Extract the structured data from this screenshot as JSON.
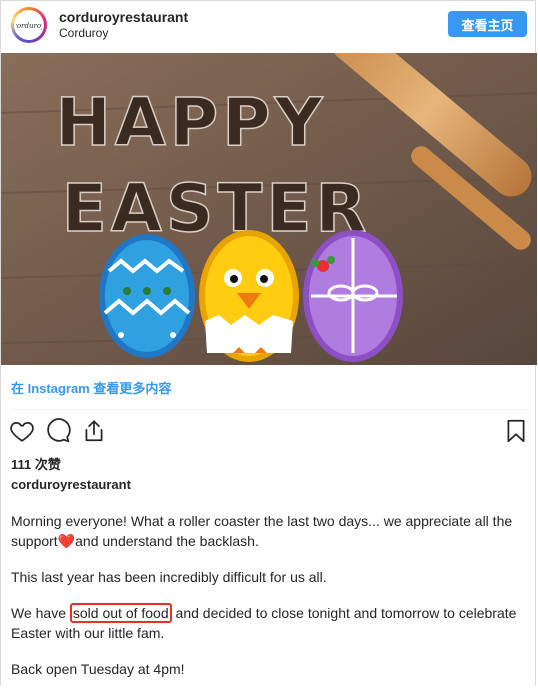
{
  "header": {
    "username": "corduroyrestaurant",
    "sublabel": "Corduroy",
    "view_profile_button": "查看主页",
    "avatar_text": "corduroy"
  },
  "photo": {
    "line1": "HAPPY",
    "line2": "EASTER"
  },
  "view_more_link": "在 Instagram 查看更多内容",
  "actions": {
    "icons": [
      "heart-icon",
      "comment-icon",
      "share-icon",
      "bookmark-icon"
    ]
  },
  "likes_text": "111 次赞",
  "author": "corduroyrestaurant",
  "caption": {
    "p1_a": "Morning everyone! What a roller coaster the last two days... we appreciate all the support",
    "p1_emoji": "❤️",
    "p1_b": "and understand the backlash.",
    "p2": "This last year has been incredibly difficult for us all.",
    "p3_a": "We have ",
    "p3_highlight": "sold out of food",
    "p3_b": " and decided to close tonight and tomorrow to celebrate Easter with our little fam.",
    "p4": "Back open Tuesday at 4pm!"
  },
  "colors": {
    "accent": "#3897f0",
    "highlight_box": "#e8302a",
    "heart": "#e0245e"
  }
}
